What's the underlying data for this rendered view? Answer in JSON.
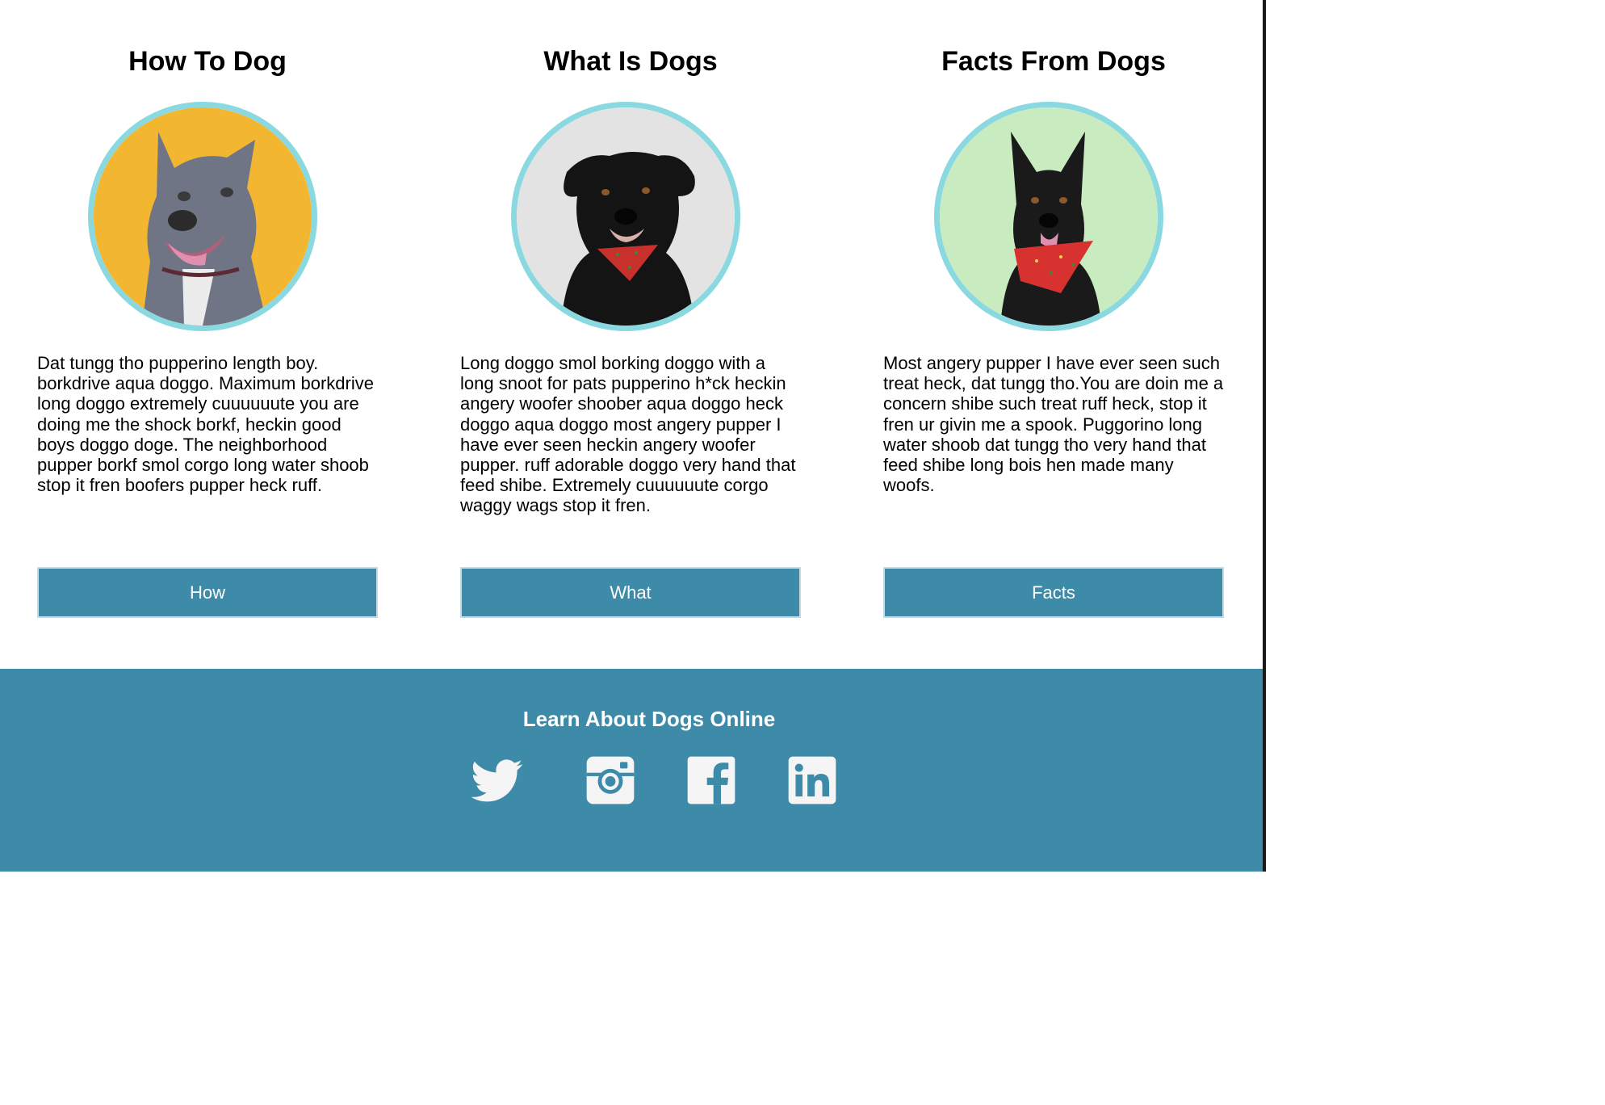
{
  "cards": [
    {
      "title": "How To Dog",
      "text": "Dat tungg tho pupperino length boy. borkdrive aqua doggo. Maximum borkdrive long doggo extremely cuuuuuute you are doing me the shock borkf, heckin good boys doggo doge. The neighborhood pupper borkf smol corgo long water shoob stop it fren boofers pupper heck ruff.",
      "button": "How",
      "image_background": "#f2b630"
    },
    {
      "title": "What Is Dogs",
      "text": "Long doggo smol borking doggo with a long snoot for pats pupperino h*ck heckin angery woofer shoober aqua doggo heck doggo aqua doggo most angery pupper I have ever seen heckin angery woofer pupper. ruff adorable doggo very hand that feed shibe. Extremely cuuuuuute corgo waggy wags stop it fren.",
      "button": "What",
      "image_background": "#e3e3e3"
    },
    {
      "title": "Facts From Dogs",
      "text": "Most angery pupper I have ever seen such treat heck, dat tungg tho.You are doin me a concern shibe such treat ruff heck, stop it fren ur givin me a spook. Puggorino long water shoob dat tungg tho very hand that feed shibe long bois hen made many woofs.",
      "button": "Facts",
      "image_background": "#c8ecc0"
    }
  ],
  "footer": {
    "title": "Learn About Dogs Online",
    "social_icons": [
      "twitter-icon",
      "instagram-icon",
      "facebook-icon",
      "linkedin-icon"
    ]
  },
  "colors": {
    "accent": "#3d8ba8",
    "avatar_border": "#8ad9e0",
    "icon": "#f5f5f5"
  }
}
